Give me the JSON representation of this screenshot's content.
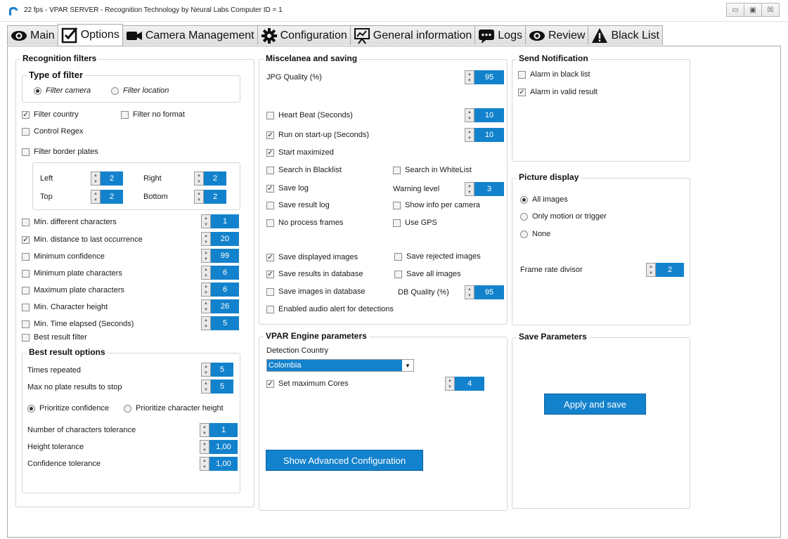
{
  "window": {
    "title": "22 fps - VPAR SERVER - Recognition Technology by Neural Labs Computer ID  = 1",
    "buttons": [
      "▭",
      "▣",
      "☒"
    ]
  },
  "tabs": [
    {
      "label": "Main",
      "icon": "eye-icon"
    },
    {
      "label": "Options",
      "icon": "checkbox-icon"
    },
    {
      "label": "Camera Management",
      "icon": "camera-icon"
    },
    {
      "label": "Configuration",
      "icon": "gear-icon"
    },
    {
      "label": "General information",
      "icon": "presentation-icon"
    },
    {
      "label": "Logs",
      "icon": "chat-icon"
    },
    {
      "label": "Review",
      "icon": "eye-icon"
    },
    {
      "label": "Black List",
      "icon": "warning-icon"
    }
  ],
  "recognition": {
    "title": "Recognition filters",
    "type_title": "Type of filter",
    "filter_camera": "Filter camera",
    "filter_location": "Filter location",
    "filter_country": "Filter country",
    "filter_no_format": "Filter no format",
    "control_regex": "Control Regex",
    "filter_border": "Filter border plates",
    "border": {
      "left": "Left",
      "right": "Right",
      "top": "Top",
      "bottom": "Bottom",
      "left_v": "2",
      "right_v": "2",
      "top_v": "2",
      "bottom_v": "2"
    },
    "items": [
      {
        "label": "Min. different characters",
        "checked": false,
        "value": "1"
      },
      {
        "label": "Min. distance to last occurrence",
        "checked": true,
        "value": "20"
      },
      {
        "label": "Minimum confidence",
        "checked": false,
        "value": "99"
      },
      {
        "label": "Minimum plate characters",
        "checked": false,
        "value": "6"
      },
      {
        "label": "Maximum plate characters",
        "checked": false,
        "value": "6"
      },
      {
        "label": "Min. Character height",
        "checked": false,
        "value": "26"
      },
      {
        "label": "Min. Time elapsed (Seconds)",
        "checked": false,
        "value": "5"
      }
    ],
    "best_filter": "Best result filter",
    "best": {
      "title": "Best result options",
      "times_repeated": "Times repeated",
      "times_repeated_v": "5",
      "max_no_plate": "Max no plate results to stop",
      "max_no_plate_v": "5",
      "prio_conf": "Prioritize confidence",
      "prio_height": "Prioritize character height",
      "num_tol": "Number of characters tolerance",
      "num_tol_v": "1",
      "height_tol": "Height tolerance",
      "height_tol_v": "1,00",
      "conf_tol": "Confidence tolerance",
      "conf_tol_v": "1,00"
    }
  },
  "misc": {
    "title": "Miscelanea and saving",
    "jpg_quality": "JPG Quality (%)",
    "jpg_quality_v": "95",
    "heart_beat": "Heart Beat (Seconds)",
    "heart_beat_v": "10",
    "run_startup": "Run on start-up (Seconds)",
    "run_startup_v": "10",
    "start_max": "Start maximized",
    "search_black": "Search in Blacklist",
    "search_white": "Search in WhiteList",
    "save_log": "Save log",
    "warning_level": "Warning level",
    "warning_level_v": "3",
    "save_result_log": "Save result log",
    "show_info": "Show info per camera",
    "no_process": "No process frames",
    "use_gps": "Use GPS",
    "save_displayed": "Save displayed images",
    "save_rejected": "Save rejected images",
    "save_results_db": "Save results in database",
    "save_all": "Save all images",
    "save_images_db": "Save images in database",
    "db_quality": "DB Quality (%)",
    "db_quality_v": "95",
    "audio_alert": "Enabled audio alert for detections"
  },
  "engine": {
    "title": "VPAR Engine parameters",
    "detection_country": "Detection Country",
    "country": "Colombia",
    "max_cores": "Set maximum Cores",
    "max_cores_v": "4",
    "advanced": "Show Advanced Configuration"
  },
  "notify": {
    "title": "Send Notification",
    "black": "Alarm in black list",
    "valid": "Alarm in valid result"
  },
  "picture": {
    "title": "Picture display",
    "all": "All images",
    "motion": "Only motion or trigger",
    "none": "None",
    "divisor": "Frame rate divisor",
    "divisor_v": "2"
  },
  "save": {
    "title": "Save Parameters",
    "apply": "Apply and save"
  }
}
